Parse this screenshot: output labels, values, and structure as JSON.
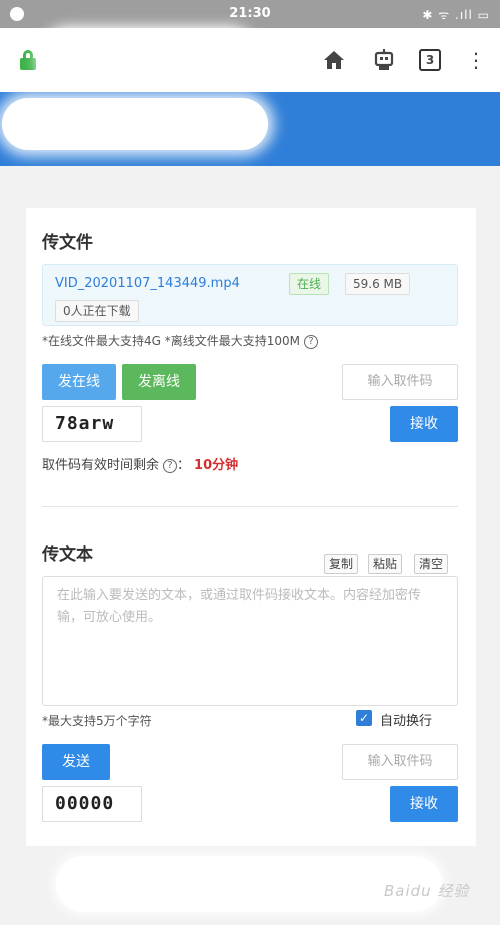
{
  "status_bar": {
    "time": "21:30",
    "icons": "✱ ᯤ .ıll ▭"
  },
  "toolbar": {
    "tab_count": "3",
    "menu": "⋮",
    "home": "⌂"
  },
  "upload": {
    "title": "传文件",
    "file_name": "VID_20201107_143449.mp4",
    "status_badge": "在线",
    "file_size": "59.6 MB",
    "downloading": "0人正在下载",
    "limits_note": "*在线文件最大支持4G  *离线文件最大支持100M",
    "help": "?",
    "send_online": "发在线",
    "send_offline": "发离线",
    "code_placeholder": "输入取件码",
    "code": "78arw",
    "receive": "接收",
    "validity_label": "取件码有效时间剩余",
    "validity_time": "10分钟"
  },
  "text": {
    "title": "传文本",
    "copy": "复制",
    "paste": "粘贴",
    "clear": "清空",
    "placeholder": "在此输入要发送的文本，或通过取件码接收文本。内容经加密传输，可放心使用。",
    "max_note": "*最大支持5万个字符",
    "auto_wrap": "自动换行",
    "send": "发送",
    "code_placeholder": "输入取件码",
    "code": "00000",
    "receive": "接收"
  },
  "watermark": "Baidu 经验"
}
